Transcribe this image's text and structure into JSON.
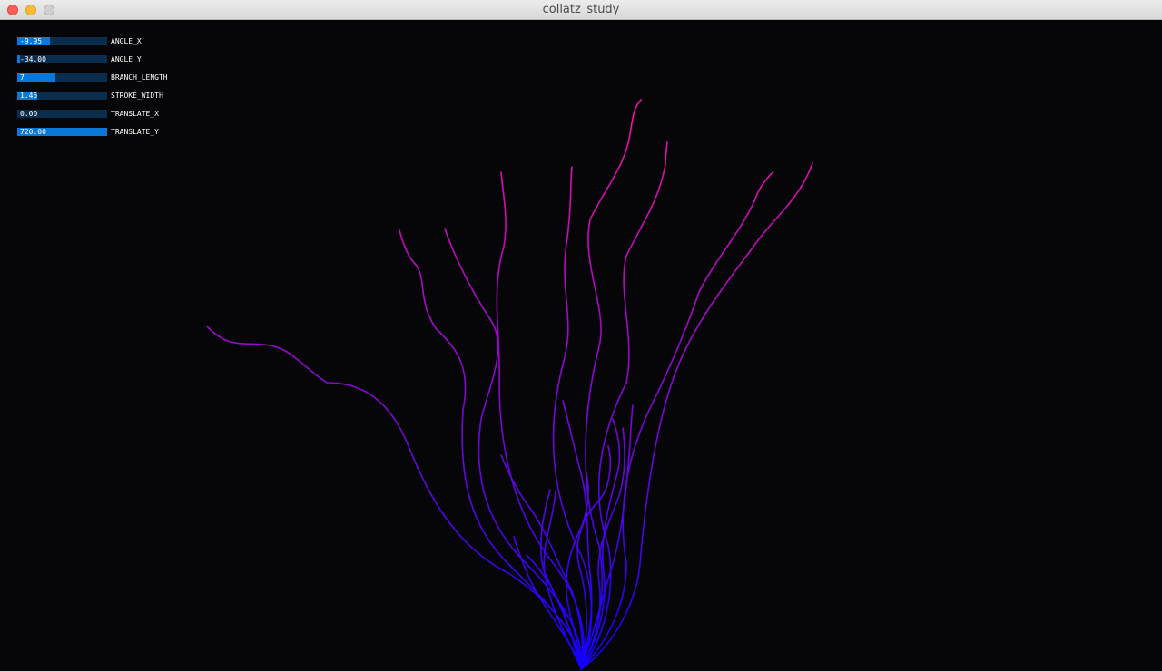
{
  "window": {
    "title": "collatz_study"
  },
  "controls": [
    {
      "label": "ANGLE_X",
      "value": "-9.95",
      "fill": 0.36
    },
    {
      "label": "ANGLE_Y",
      "value": "-34.00",
      "fill": 0.03
    },
    {
      "label": "BRANCH_LENGTH",
      "value": "7",
      "fill": 0.42
    },
    {
      "label": "STROKE_WIDTH",
      "value": "1.45",
      "fill": 0.22
    },
    {
      "label": "TRANSLATE_X",
      "value": "0.00",
      "fill": 0.0
    },
    {
      "label": "TRANSLATE_Y",
      "value": "720.00",
      "fill": 1.0
    }
  ],
  "colors": {
    "background": "#060608",
    "slider_track": "#0a2d4d",
    "slider_fill": "#0a78d8",
    "branch_root": "#1000ff",
    "branch_tip": "#ff10a0"
  }
}
